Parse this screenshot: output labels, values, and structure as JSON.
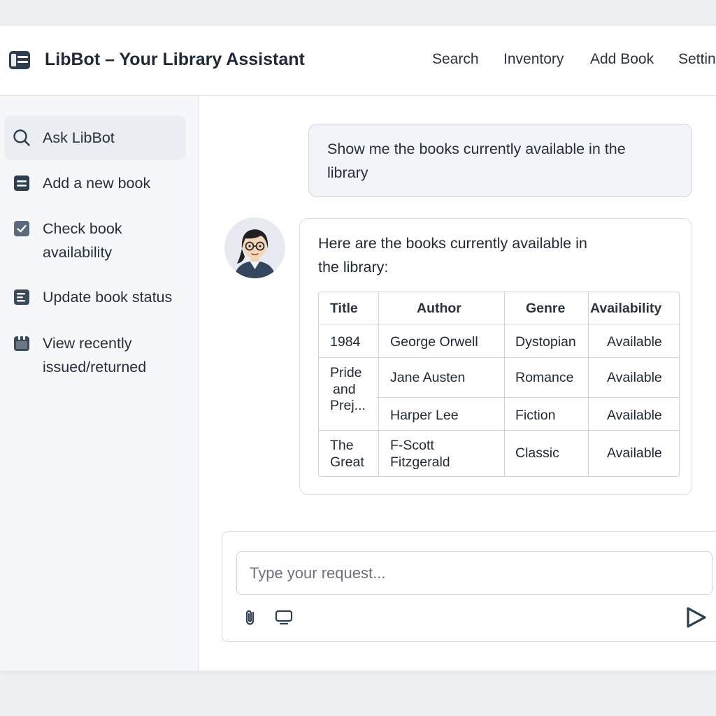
{
  "header": {
    "title": "LibBot – Your Library Assistant",
    "logo_icon": "book-stack-icon",
    "nav": [
      "Search",
      "Inventory",
      "Add Book",
      "Settings"
    ]
  },
  "sidebar": {
    "items": [
      {
        "label": "Ask LibBot",
        "icon": "search-icon"
      },
      {
        "label": "Add a new book",
        "icon": "book-icon"
      },
      {
        "label_line1": "Check book",
        "label_line2": "availability",
        "icon": "checkbox-icon"
      },
      {
        "label": "Update book status",
        "icon": "edit-document-icon"
      },
      {
        "label_line1": "View recently",
        "label_line2": "issued/returned",
        "icon": "calendar-icon"
      }
    ]
  },
  "chat": {
    "user_message_line1": "Show me the books currently available in the",
    "user_message_line2": "library",
    "bot_message_line1": "Here are the books currently available in",
    "bot_message_line2": "the library:",
    "avatar_icon": "librarian-avatar-icon",
    "table": {
      "headers": [
        "Title",
        "Author",
        "Genre",
        "Availability"
      ],
      "rows": [
        {
          "title_lines": [
            "1984"
          ],
          "author_lines": [
            "George Orwell"
          ],
          "genre": "Dystopian",
          "availability": "Available"
        },
        {
          "title_lines": [
            "Pride",
            "and",
            "Prej..."
          ],
          "author_lines": [
            "Jane Austen"
          ],
          "genre": "Romance",
          "availability": "Available"
        },
        {
          "title_lines": [],
          "author_lines": [
            "Harper Lee"
          ],
          "genre": "Fiction",
          "availability": "Available"
        },
        {
          "title_lines": [
            "The",
            "Great"
          ],
          "author_lines": [
            "F-Scott",
            "Fitzgerald"
          ],
          "genre": "Classic",
          "availability": "Available"
        }
      ]
    }
  },
  "composer": {
    "placeholder": "Type your request...",
    "value": "",
    "attach_icon": "paperclip-icon",
    "screen_icon": "monitor-icon",
    "send_icon": "send-icon"
  },
  "colors": {
    "accent": "#2d3e50",
    "background": "#eef0f3",
    "sidebar_bg": "#f6f7f9",
    "user_bubble": "#f1f4f8"
  }
}
